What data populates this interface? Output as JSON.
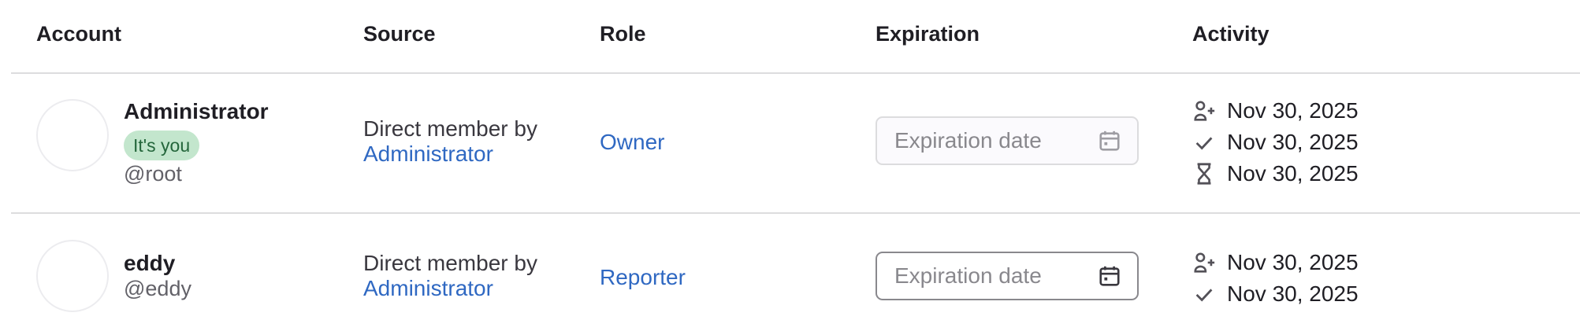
{
  "columns": {
    "account": "Account",
    "source": "Source",
    "role": "Role",
    "expiration": "Expiration",
    "activity": "Activity"
  },
  "members": [
    {
      "name": "Administrator",
      "badge": "It's you",
      "username": "@root",
      "source_prefix": "Direct member by",
      "source_user": "Administrator",
      "role": "Owner",
      "expiration_placeholder": "Expiration date",
      "activity": [
        {
          "icon": "user-add-icon",
          "date": "Nov 30, 2025"
        },
        {
          "icon": "check-icon",
          "date": "Nov 30, 2025"
        },
        {
          "icon": "hourglass-icon",
          "date": "Nov 30, 2025"
        }
      ]
    },
    {
      "name": "eddy",
      "username": "@eddy",
      "source_prefix": "Direct member by",
      "source_user": "Administrator",
      "role": "Reporter",
      "expiration_placeholder": "Expiration date",
      "activity": [
        {
          "icon": "user-add-icon",
          "date": "Nov 30, 2025"
        },
        {
          "icon": "check-icon",
          "date": "Nov 30, 2025"
        }
      ]
    }
  ]
}
